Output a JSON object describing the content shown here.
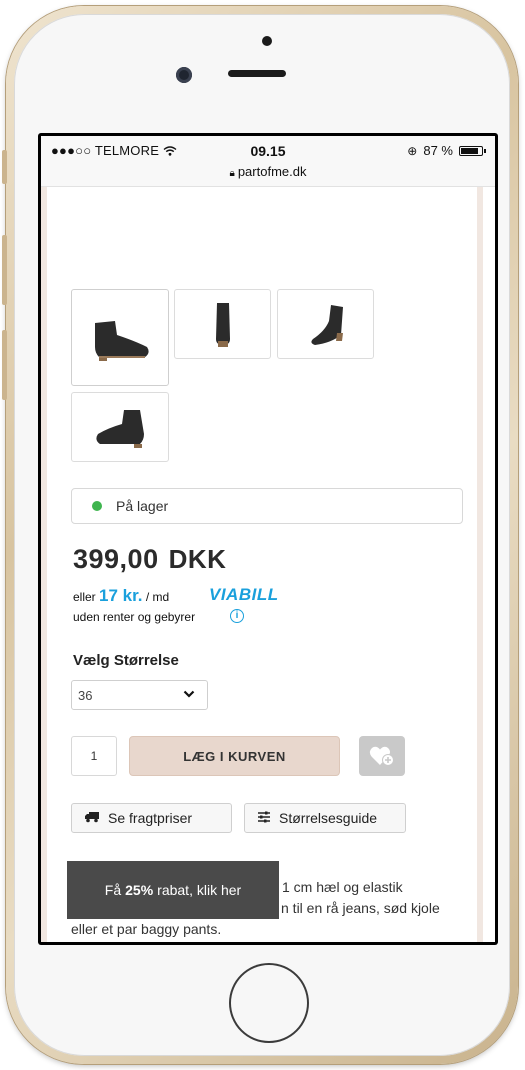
{
  "status_bar": {
    "carrier": "●●●○○ TELMORE",
    "wifi_icon": "wifi-icon",
    "time": "09.15",
    "battery_percent": "87 %",
    "battery_level": 0.87,
    "url": "partofme.dk"
  },
  "product": {
    "thumbnails": [
      {
        "icon": "boot-side-left-icon",
        "active": true
      },
      {
        "icon": "boot-back-icon",
        "active": false
      },
      {
        "icon": "boot-angle-icon",
        "active": false
      },
      {
        "icon": "boot-side-right-icon",
        "active": false
      }
    ],
    "stock_status": "På lager",
    "stock_color": "#3fb54f",
    "price_amount": "399,00",
    "price_currency": "DKK",
    "finance_prefix": "eller",
    "finance_amount": "17 kr.",
    "finance_suffix": "/ md",
    "finance_note": "uden renter og gebyrer",
    "finance_brand": "VIABILL",
    "finance_brand_color": "#1aa0dc",
    "size_label": "Vælg Størrelse",
    "size_selected": "36",
    "quantity": "1",
    "add_to_cart_label": "LÆG I KURVEN",
    "shipping_label": "Se fragtpriser",
    "size_guide_label": "Størrelsesguide",
    "description_line1": "1 cm hæl og elastik",
    "description_line2": "n til en rå jeans, sød kjole",
    "description_line3": "eller et par baggy pants."
  },
  "promo": {
    "prefix": "Få",
    "highlight": "25%",
    "suffix": "rabat, klik her"
  }
}
